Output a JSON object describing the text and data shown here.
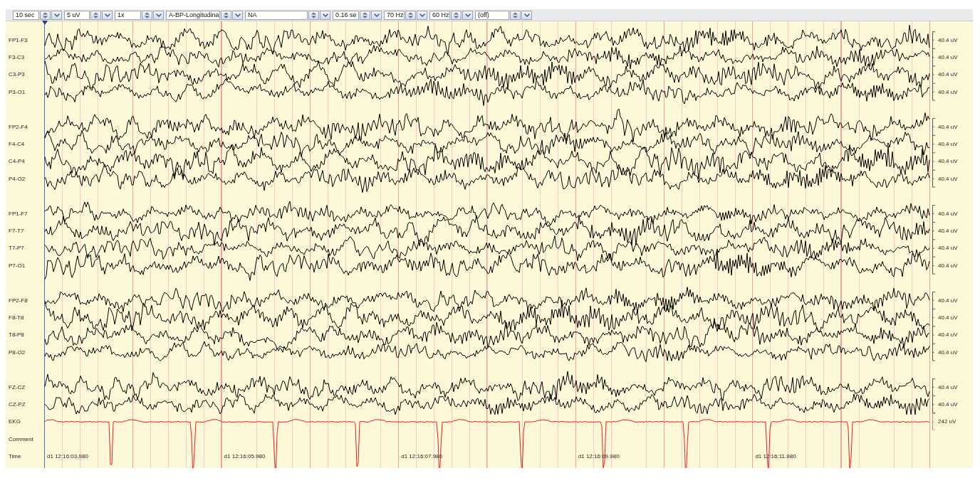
{
  "toolbar": {
    "controls": [
      {
        "value": "10 sec"
      },
      {
        "value": "5 uV"
      },
      {
        "value": "1x"
      },
      {
        "value": "A-BP-Longitudina"
      },
      {
        "value": "NA"
      },
      {
        "value": "0.16 se"
      },
      {
        "value": "70 Hz"
      },
      {
        "value": "60 Hz"
      },
      {
        "value": "(off)"
      }
    ]
  },
  "groups": [
    {
      "channels": [
        {
          "label": "FP1-F3",
          "scale": "40.4 uV",
          "kind": "eeg",
          "color": "#000000"
        },
        {
          "label": "F3-C3",
          "scale": "40.4 uV",
          "kind": "eeg",
          "color": "#000000"
        },
        {
          "label": "C3-P3",
          "scale": "40.4 uV",
          "kind": "eeg",
          "color": "#000000"
        },
        {
          "label": "P3-O1",
          "scale": "40.4 uV",
          "kind": "eeg",
          "color": "#000000"
        }
      ]
    },
    {
      "channels": [
        {
          "label": "FP2-F4",
          "scale": "40.4 uV",
          "kind": "eeg",
          "color": "#000000"
        },
        {
          "label": "F4-C4",
          "scale": "40.4 uV",
          "kind": "eeg",
          "color": "#000000"
        },
        {
          "label": "C4-P4",
          "scale": "40.4 uV",
          "kind": "eeg",
          "color": "#000000"
        },
        {
          "label": "P4-O2",
          "scale": "40.4 uV",
          "kind": "eeg",
          "color": "#000000"
        }
      ]
    },
    {
      "channels": [
        {
          "label": "FP1-F7",
          "scale": "40.4 uV",
          "kind": "eeg",
          "color": "#000000"
        },
        {
          "label": "F7-T7",
          "scale": "40.4 uV",
          "kind": "eeg",
          "color": "#000000"
        },
        {
          "label": "T7-P7",
          "scale": "40.4 uV",
          "kind": "eeg",
          "color": "#000000"
        },
        {
          "label": "P7-O1",
          "scale": "40.4 uV",
          "kind": "eeg",
          "color": "#000000"
        }
      ]
    },
    {
      "channels": [
        {
          "label": "FP2-F8",
          "scale": "40.4 uV",
          "kind": "eeg",
          "color": "#000000"
        },
        {
          "label": "F8-T8",
          "scale": "40.4 uV",
          "kind": "eeg",
          "color": "#000000"
        },
        {
          "label": "T8-P8",
          "scale": "40.4 uV",
          "kind": "eeg",
          "color": "#000000"
        },
        {
          "label": "P8-O2",
          "scale": "40.4 uV",
          "kind": "eeg",
          "color": "#000000"
        }
      ]
    },
    {
      "channels": [
        {
          "label": "FZ-CZ",
          "scale": "40.4 uV",
          "kind": "eeg",
          "color": "#000000"
        },
        {
          "label": "CZ-PZ",
          "scale": "40.4 uV",
          "kind": "eeg",
          "color": "#000000"
        }
      ]
    },
    {
      "channels": [
        {
          "label": "EKG",
          "scale": "242 uV",
          "kind": "ekg",
          "color": "#e82020"
        }
      ]
    }
  ],
  "comment_row": {
    "label": "Comment"
  },
  "time_row": {
    "label": "Time",
    "marks": [
      "d1 12:16:03.980",
      "d1 12:16:05.980",
      "d1 12:16:07.980",
      "d1 12:16:09.980",
      "d1 12:16:11.980"
    ]
  }
}
